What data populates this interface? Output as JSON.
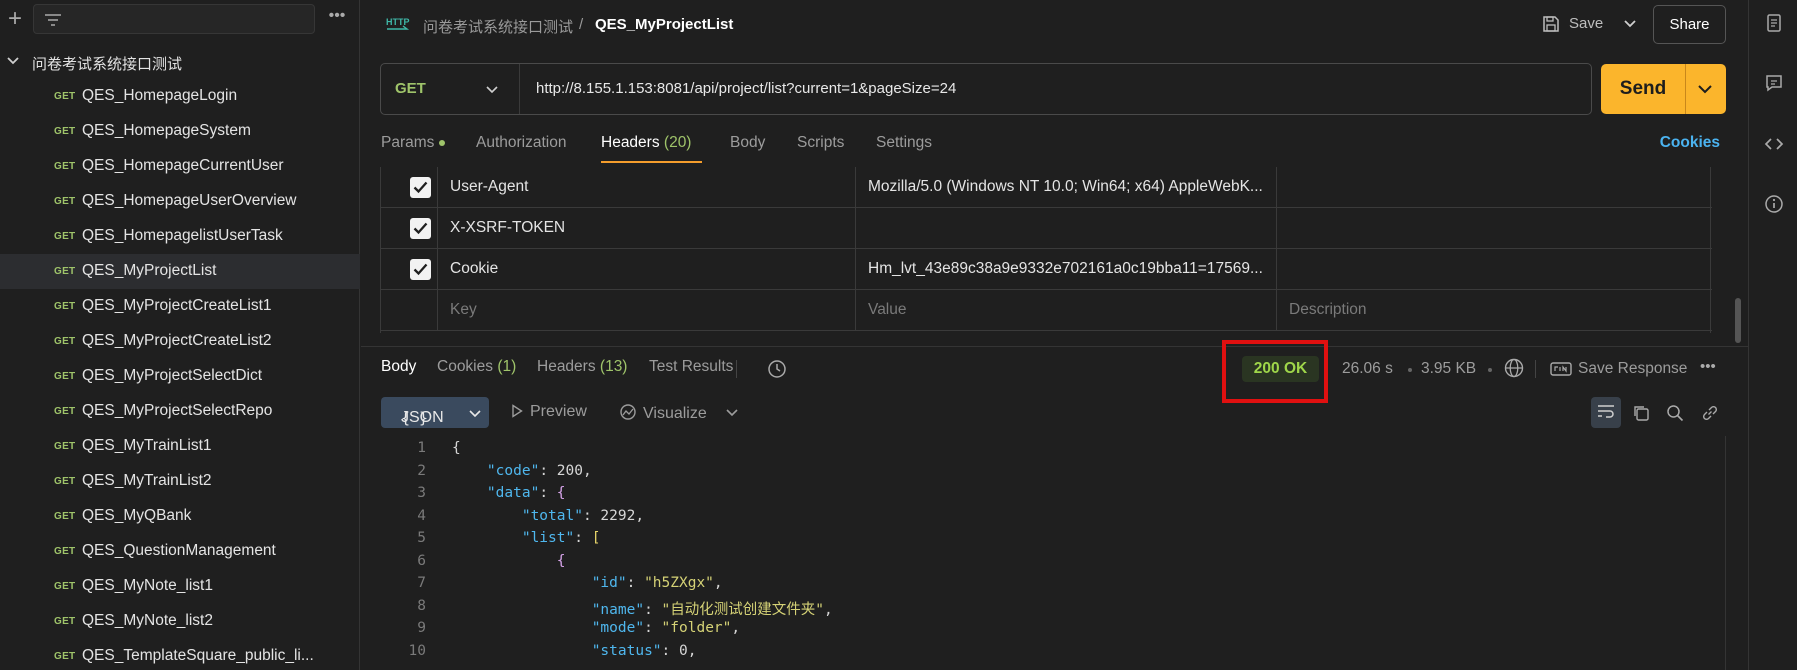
{
  "sidebar": {
    "folder": "问卷考试系统接口测试",
    "items": [
      {
        "method": "GET",
        "name": "QES_HomepageLogin"
      },
      {
        "method": "GET",
        "name": "QES_HomepageSystem"
      },
      {
        "method": "GET",
        "name": "QES_HomepageCurrentUser"
      },
      {
        "method": "GET",
        "name": "QES_HomepageUserOverview"
      },
      {
        "method": "GET",
        "name": "QES_HomepagelistUserTask"
      },
      {
        "method": "GET",
        "name": "QES_MyProjectList"
      },
      {
        "method": "GET",
        "name": "QES_MyProjectCreateList1"
      },
      {
        "method": "GET",
        "name": "QES_MyProjectCreateList2"
      },
      {
        "method": "GET",
        "name": "QES_MyProjectSelectDict"
      },
      {
        "method": "GET",
        "name": "QES_MyProjectSelectRepo"
      },
      {
        "method": "GET",
        "name": "QES_MyTrainList1"
      },
      {
        "method": "GET",
        "name": "QES_MyTrainList2"
      },
      {
        "method": "GET",
        "name": "QES_MyQBank"
      },
      {
        "method": "GET",
        "name": "QES_QuestionManagement"
      },
      {
        "method": "GET",
        "name": "QES_MyNote_list1"
      },
      {
        "method": "GET",
        "name": "QES_MyNote_list2"
      },
      {
        "method": "GET",
        "name": "QES_TemplateSquare_public_li..."
      }
    ]
  },
  "header": {
    "breadcrumb_parent": "问卷考试系统接口测试",
    "breadcrumb_sep": "/",
    "breadcrumb_current": "QES_MyProjectList",
    "save_label": "Save",
    "share_label": "Share",
    "http_icon_text": "HTTP"
  },
  "request": {
    "method": "GET",
    "url": "http://8.155.1.153:8081/api/project/list?current=1&pageSize=24",
    "send_label": "Send"
  },
  "req_tabs": {
    "params": "Params",
    "authorization": "Authorization",
    "headers": "Headers",
    "headers_count": "(20)",
    "body": "Body",
    "scripts": "Scripts",
    "settings": "Settings",
    "cookies": "Cookies"
  },
  "headers_table": {
    "rows": [
      {
        "key": "User-Agent",
        "value": "Mozilla/5.0 (Windows NT 10.0; Win64; x64) AppleWebK..."
      },
      {
        "key": "X-XSRF-TOKEN",
        "value": ""
      },
      {
        "key": "Cookie",
        "value": "Hm_lvt_43e89c38a9e9332e702161a0c19bba11=17569..."
      }
    ],
    "placeholders": {
      "key": "Key",
      "value": "Value",
      "description": "Description"
    }
  },
  "response": {
    "tabs": {
      "body": "Body",
      "cookies": "Cookies",
      "cookies_count": "(1)",
      "headers": "Headers",
      "headers_count": "(13)",
      "test_results": "Test Results"
    },
    "status": "200 OK",
    "time": "26.06 s",
    "size": "3.95 KB",
    "save_response": "Save Response",
    "format": "JSON",
    "preview": "Preview",
    "visualize": "Visualize"
  },
  "code": {
    "line_numbers": [
      "1",
      "2",
      "3",
      "4",
      "5",
      "6",
      "7",
      "8",
      "9",
      "10"
    ],
    "keys": {
      "code": "\"code\"",
      "data": "\"data\"",
      "total": "\"total\"",
      "list": "\"list\"",
      "id": "\"id\"",
      "name": "\"name\"",
      "mode": "\"mode\"",
      "status": "\"status\""
    },
    "values": {
      "code": "200",
      "total": "2292",
      "id": "\"h5ZXgx\"",
      "name": "\"自动化测试创建文件夹\"",
      "mode": "\"folder\"",
      "status": "0"
    }
  },
  "colors": {
    "accent_send": "#fbb52c",
    "method_get": "#9fc46a",
    "status_ok": "#9fd64a",
    "highlight_box": "#e01010",
    "link": "#4bb3f0"
  }
}
